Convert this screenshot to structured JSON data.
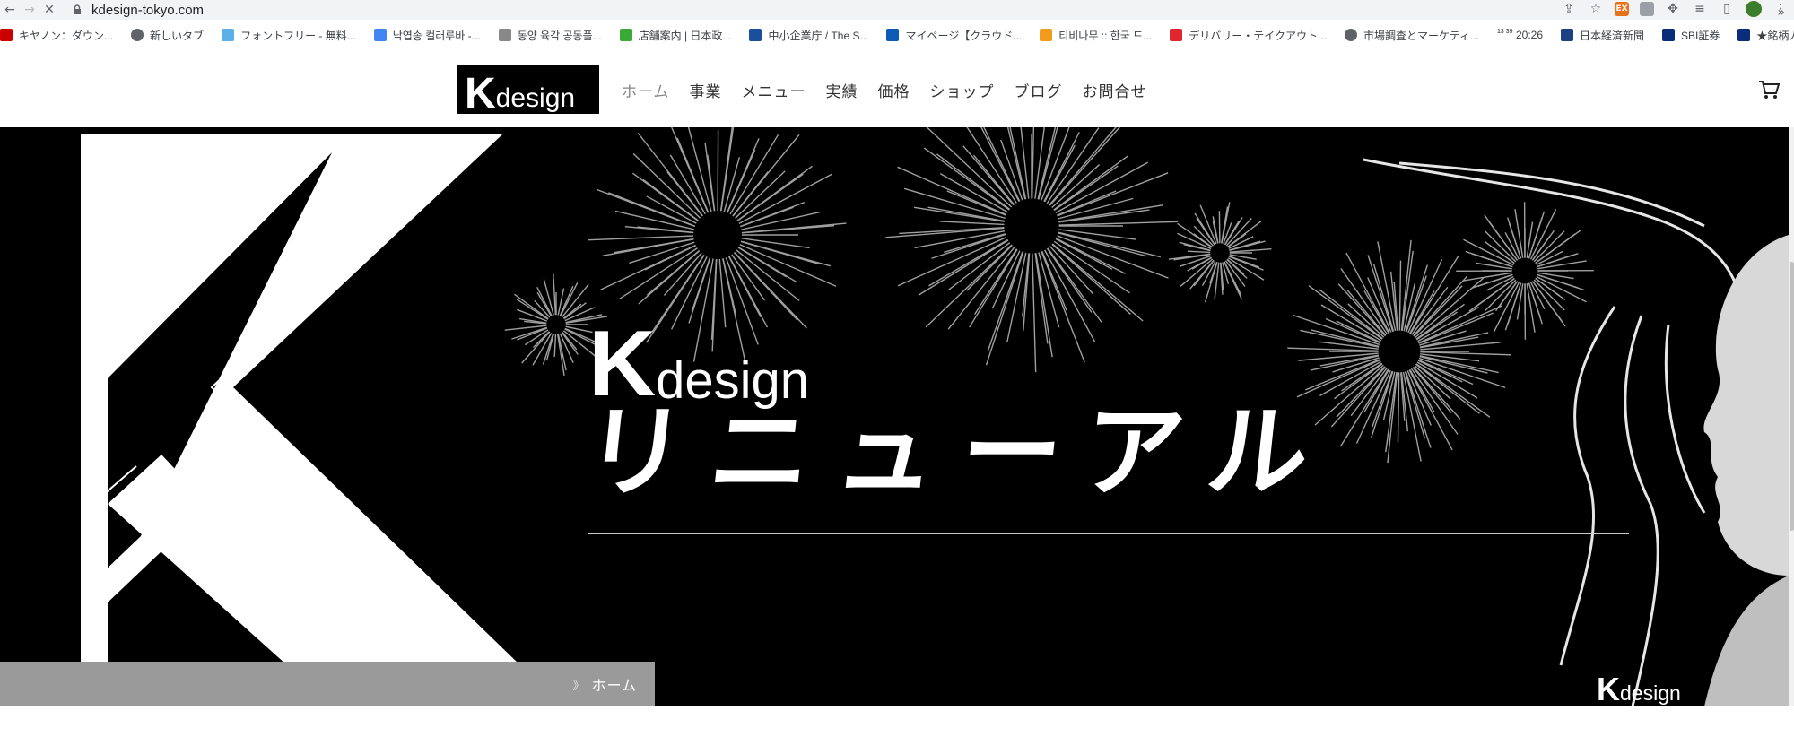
{
  "browser": {
    "url": "kdesign-tokyo.com",
    "bookmarks": [
      {
        "label": "キヤノン：ダウン...",
        "icon": "canon-icon",
        "color": "#cc0000"
      },
      {
        "label": "新しいタブ",
        "icon": "globe-icon",
        "color": "#5f6368"
      },
      {
        "label": "フォントフリー - 無料...",
        "icon": "font-free-icon",
        "color": "#5bb0e8"
      },
      {
        "label": "낙엽송 컬러루바 -...",
        "icon": "google-icon",
        "color": "#4285f4"
      },
      {
        "label": "동양 육각 공동플...",
        "icon": "cart-icon",
        "color": "#888888"
      },
      {
        "label": "店舗案内 | 日本政...",
        "icon": "jfc-icon",
        "color": "#3aa935"
      },
      {
        "label": "中小企業庁 / The S...",
        "icon": "meti-icon",
        "color": "#1a4f9c"
      },
      {
        "label": "マイページ【クラウド...",
        "icon": "cw-icon",
        "color": "#0d5bb5"
      },
      {
        "label": "티비나무 :: 한국 드...",
        "icon": "tvnamu-icon",
        "color": "#f29b1d"
      },
      {
        "label": "デリバリー・テイクアウト...",
        "icon": "demaecan-icon",
        "color": "#e0262e"
      },
      {
        "label": "市場調査とマーケティ...",
        "icon": "globe-icon",
        "color": "#5f6368"
      },
      {
        "label": "20:26",
        "icon": "clock-icon",
        "color": "#5f6368"
      },
      {
        "label": "日本経済新聞",
        "icon": "nikkei-icon",
        "color": "#1d3f84"
      },
      {
        "label": "SBI証券",
        "icon": "sbi-icon",
        "color": "#0a2d7a"
      },
      {
        "label": "★銘柄人気ランキ...",
        "icon": "sbi-icon",
        "color": "#0a2d7a"
      }
    ],
    "clock_fav": "13 39"
  },
  "site": {
    "logo": {
      "k": "K",
      "rest": "design"
    },
    "nav": [
      {
        "label": "ホーム",
        "active": true
      },
      {
        "label": "事業",
        "active": false
      },
      {
        "label": "メニュー",
        "active": false
      },
      {
        "label": "実績",
        "active": false
      },
      {
        "label": "価格",
        "active": false
      },
      {
        "label": "ショップ",
        "active": false
      },
      {
        "label": "ブログ",
        "active": false
      },
      {
        "label": "お問合せ",
        "active": false
      }
    ]
  },
  "hero": {
    "brand_k": "K",
    "brand_rest": "design",
    "title": "リニューアル",
    "corner_k": "K",
    "corner_rest": "design"
  },
  "breadcrumb": {
    "separator": "》",
    "home": "ホーム"
  },
  "colors": {
    "hero_bg": "#000000",
    "breadcrumb_bg": "#9a9a9a",
    "nav_active": "#888888"
  }
}
